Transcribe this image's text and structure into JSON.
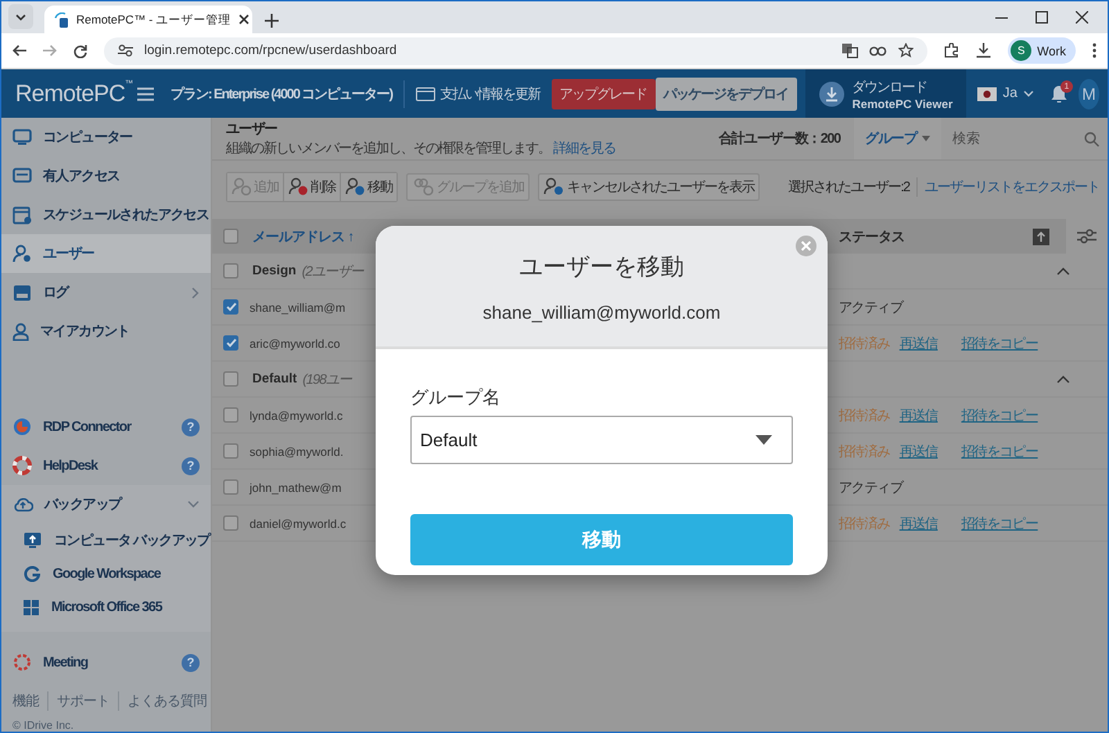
{
  "browser": {
    "tab_title": "RemotePC™ - ユーザー管理",
    "url": "login.remotepc.com/rpcnew/userdashboard",
    "profile_initial": "S",
    "profile_name": "Work"
  },
  "header": {
    "logo": "RemotePC",
    "logo_mark": "™",
    "plan": "プラン: Enterprise (4000 コンピューター)",
    "billing": "支払い情報を更新",
    "upgrade": "アップグレード",
    "deploy": "パッケージをデプロイ",
    "download_title": "ダウンロード",
    "download_subtitle": "RemotePC Viewer",
    "language": "Ja",
    "notification_count": "1",
    "avatar": "M"
  },
  "sidebar": {
    "items": [
      {
        "label": "コンピューター",
        "selected": false
      },
      {
        "label": "有人アクセス",
        "selected": false
      },
      {
        "label": "スケジュールされたアクセス",
        "selected": false
      },
      {
        "label": "ユーザー",
        "selected": true
      },
      {
        "label": "ログ",
        "selected": false,
        "expanded": false
      },
      {
        "label": "マイアカウント",
        "selected": false
      }
    ],
    "tools": [
      {
        "label": "RDP Connector",
        "help": "?"
      },
      {
        "label": "HelpDesk",
        "help": "?"
      },
      {
        "label": "バックアップ",
        "expanded": true,
        "children": [
          {
            "label": "コンピュータ バックアップ"
          },
          {
            "label": "Google Workspace"
          },
          {
            "label": "Microsoft Office 365"
          }
        ]
      },
      {
        "label": "Meeting",
        "help": "?"
      }
    ],
    "footer_links": [
      "機能",
      "サポート",
      "よくある質問"
    ],
    "copyright": "© IDrive Inc."
  },
  "content": {
    "title": "ユーザー",
    "description": "組織の新しいメンバーを追加し、その権限を管理します。",
    "more_link": "詳細を見る",
    "total_users": "合計ユーザー数：200",
    "group_filter": "グループ",
    "search": {
      "placeholder": "検索"
    },
    "toolbar_group": [
      {
        "label": "追加",
        "disabled": true
      },
      {
        "label": "削除",
        "disabled": false
      },
      {
        "label": "移動",
        "disabled": false
      }
    ],
    "toolbar": [
      {
        "label": "グループを追加",
        "disabled": true
      },
      {
        "label": "キャンセルされたユーザーを表示",
        "disabled": false
      }
    ],
    "selected_count": "選択されたユーザー:2",
    "export_link": "ユーザーリストをエクスポート"
  },
  "table": {
    "all_checked": false,
    "columns": [
      "メールアドレス ↑",
      "ステータス"
    ],
    "rows": [
      {
        "kind": "group",
        "name": "Design",
        "count": "(2ユーザー",
        "checked": false,
        "expanded": true
      },
      {
        "kind": "user",
        "email": "shane_william@m",
        "checked": true,
        "status": "アクティブ",
        "color": "#2e2e2e"
      },
      {
        "kind": "user",
        "email": "aric@myworld.co",
        "checked": true,
        "status": "招待済み",
        "color": "#a06c40",
        "actions": [
          "再送信",
          "招待をコピー"
        ]
      },
      {
        "kind": "group",
        "name": "Default",
        "count": "(198ユー",
        "checked": false,
        "expanded": true
      },
      {
        "kind": "user",
        "email": "lynda@myworld.c",
        "checked": false,
        "status": "招待済み",
        "color": "#a06c40",
        "actions": [
          "再送信",
          "招待をコピー"
        ]
      },
      {
        "kind": "user",
        "email": "sophia@myworld.",
        "checked": false,
        "status": "招待済み",
        "color": "#a06c40",
        "actions": [
          "再送信",
          "招待をコピー"
        ]
      },
      {
        "kind": "user",
        "email": "john_mathew@m",
        "checked": false,
        "status": "アクティブ",
        "color": "#2e2e2e"
      },
      {
        "kind": "user",
        "email": "daniel@myworld.c",
        "checked": false,
        "status": "招待済み",
        "color": "#a06c40",
        "actions": [
          "再送信",
          "招待をコピー"
        ]
      }
    ]
  },
  "modal": {
    "title": "ユーザーを移動",
    "email": "shane_william@myworld.com",
    "field_label": "グループ名",
    "group": "Default",
    "button": "移動"
  }
}
